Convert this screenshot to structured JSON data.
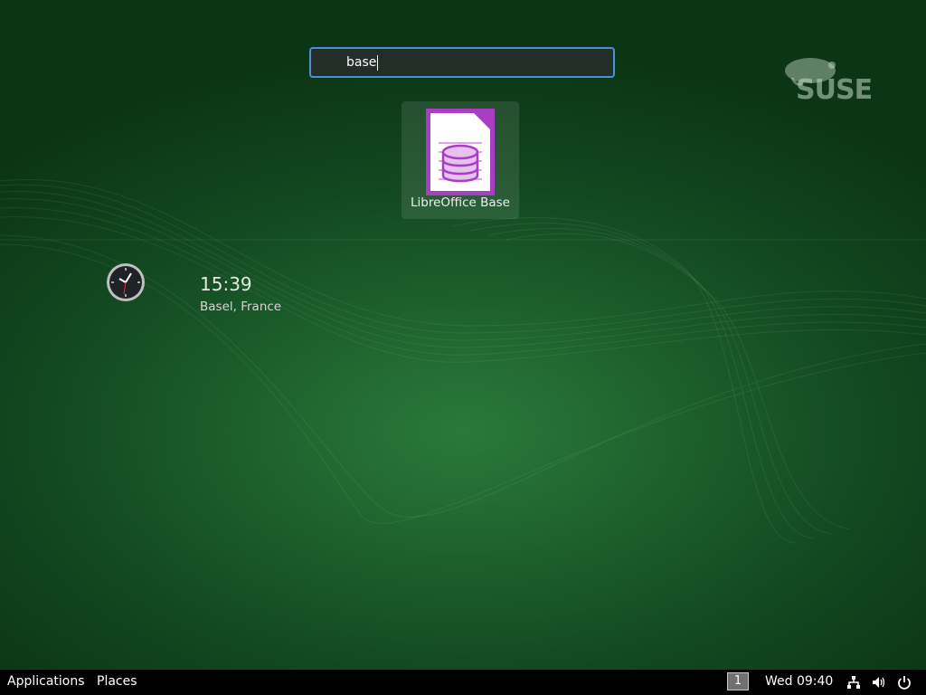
{
  "desktop": {
    "brand": "SUSE"
  },
  "search": {
    "query": "base"
  },
  "results": [
    {
      "label": "LibreOffice Base",
      "icon": "libreoffice-base-icon"
    }
  ],
  "world_clock": {
    "time": "15:39",
    "location": "Basel, France"
  },
  "taskbar": {
    "applications_label": "Applications",
    "places_label": "Places",
    "workspace": "1",
    "datetime": "Wed 09:40",
    "tray_icons": [
      "network-icon",
      "volume-icon",
      "power-icon"
    ]
  },
  "colors": {
    "focus_border": "#4a90d9",
    "base_purple": "#a83ec4"
  }
}
